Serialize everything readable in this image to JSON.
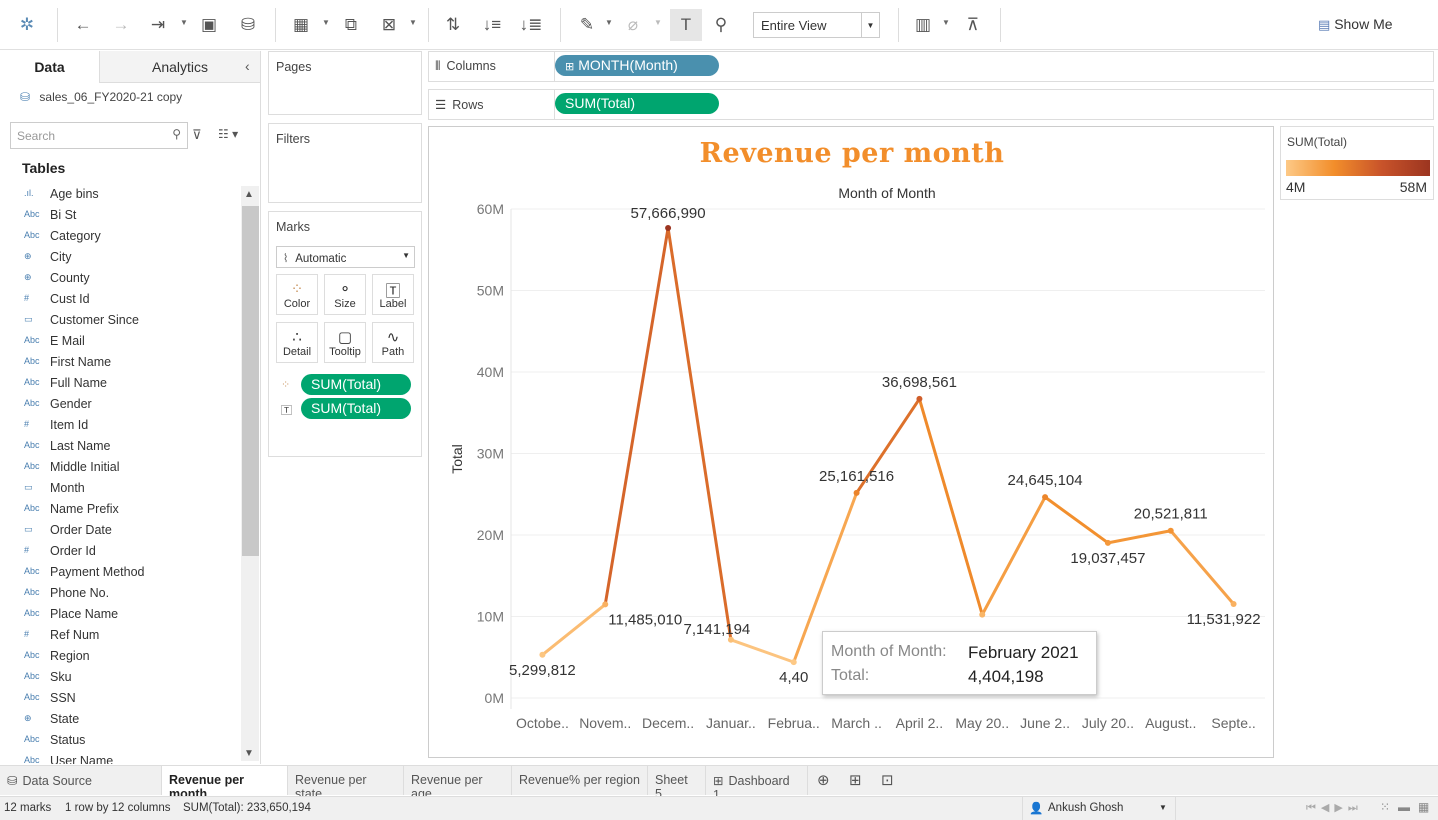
{
  "toolbar": {
    "view_select": "Entire View",
    "show_me": "Show Me"
  },
  "data_pane": {
    "tab_data": "Data",
    "tab_analytics": "Analytics",
    "datasource": "sales_06_FY2020-21 copy",
    "search_placeholder": "Search",
    "tables_header": "Tables",
    "fields": [
      {
        "icon": ".ıl.",
        "name": "Age bins"
      },
      {
        "icon": "Abc",
        "name": "Bi St"
      },
      {
        "icon": "Abc",
        "name": "Category"
      },
      {
        "icon": "⊕",
        "name": "City"
      },
      {
        "icon": "⊕",
        "name": "County"
      },
      {
        "icon": "#",
        "name": "Cust Id"
      },
      {
        "icon": "▭",
        "name": "Customer Since"
      },
      {
        "icon": "Abc",
        "name": "E Mail"
      },
      {
        "icon": "Abc",
        "name": "First Name"
      },
      {
        "icon": "Abc",
        "name": "Full Name"
      },
      {
        "icon": "Abc",
        "name": "Gender"
      },
      {
        "icon": "#",
        "name": "Item Id"
      },
      {
        "icon": "Abc",
        "name": "Last Name"
      },
      {
        "icon": "Abc",
        "name": "Middle Initial"
      },
      {
        "icon": "▭",
        "name": "Month"
      },
      {
        "icon": "Abc",
        "name": "Name Prefix"
      },
      {
        "icon": "▭",
        "name": "Order Date"
      },
      {
        "icon": "#",
        "name": "Order Id"
      },
      {
        "icon": "Abc",
        "name": "Payment Method"
      },
      {
        "icon": "Abc",
        "name": "Phone No."
      },
      {
        "icon": "Abc",
        "name": "Place Name"
      },
      {
        "icon": "#",
        "name": "Ref Num"
      },
      {
        "icon": "Abc",
        "name": "Region"
      },
      {
        "icon": "Abc",
        "name": "Sku"
      },
      {
        "icon": "Abc",
        "name": "SSN"
      },
      {
        "icon": "⊕",
        "name": "State"
      },
      {
        "icon": "Abc",
        "name": "Status"
      },
      {
        "icon": "Abc",
        "name": "User Name"
      }
    ]
  },
  "cards": {
    "pages": "Pages",
    "filters": "Filters",
    "marks": "Marks",
    "mark_type": "Automatic",
    "mark_buttons": [
      "Color",
      "Size",
      "Label",
      "Detail",
      "Tooltip",
      "Path"
    ],
    "mark_pill_1": "SUM(Total)",
    "mark_pill_2": "SUM(Total)"
  },
  "shelves": {
    "columns_label": "Columns",
    "columns_pill": "MONTH(Month)",
    "rows_label": "Rows",
    "rows_pill": "SUM(Total)"
  },
  "chart_data": {
    "type": "line",
    "title": "Revenue per month",
    "subtitle": "Month of Month",
    "ylabel": "Total",
    "xlabel": "",
    "ylim": [
      0,
      60000000
    ],
    "yticks": [
      "0M",
      "10M",
      "20M",
      "30M",
      "40M",
      "50M",
      "60M"
    ],
    "categories": [
      "Octobe..",
      "Novem..",
      "Decem..",
      "Januar..",
      "Februa..",
      "March ..",
      "April 2..",
      "May 20..",
      "June 2..",
      "July 20..",
      "August..",
      "Septe.."
    ],
    "values": [
      5299812,
      11485010,
      57666990,
      7141194,
      4404198,
      25161516,
      36698561,
      10230000,
      24645104,
      19037457,
      20521811,
      11531922
    ],
    "data_labels": [
      "5,299,812",
      "11,485,010",
      "57,666,990",
      "7,141,194",
      "4,40",
      "25,161,516",
      "36,698,561",
      "",
      "24,645,104",
      "19,037,457",
      "20,521,811",
      "11,531,922"
    ],
    "grid": true,
    "color_scale": [
      "#fdc986",
      "#f28e2b",
      "#c8532a",
      "#9c3520"
    ]
  },
  "tooltip": {
    "k1": "Month of Month:",
    "v1": "February 2021",
    "k2": "Total:",
    "v2": "4,404,198"
  },
  "legend": {
    "title": "SUM(Total)",
    "min": "4M",
    "max": "58M"
  },
  "sheet_tabs": {
    "datasource": "Data Source",
    "tabs": [
      "Revenue per month",
      "Revenue per state",
      "Revenue per age",
      "Revenue% per region",
      "Sheet 5",
      "Dashboard 1"
    ]
  },
  "status": {
    "marks": "12 marks",
    "shape": "1 row by 12 columns",
    "sum": "SUM(Total): 233,650,194",
    "user": "Ankush Ghosh"
  }
}
